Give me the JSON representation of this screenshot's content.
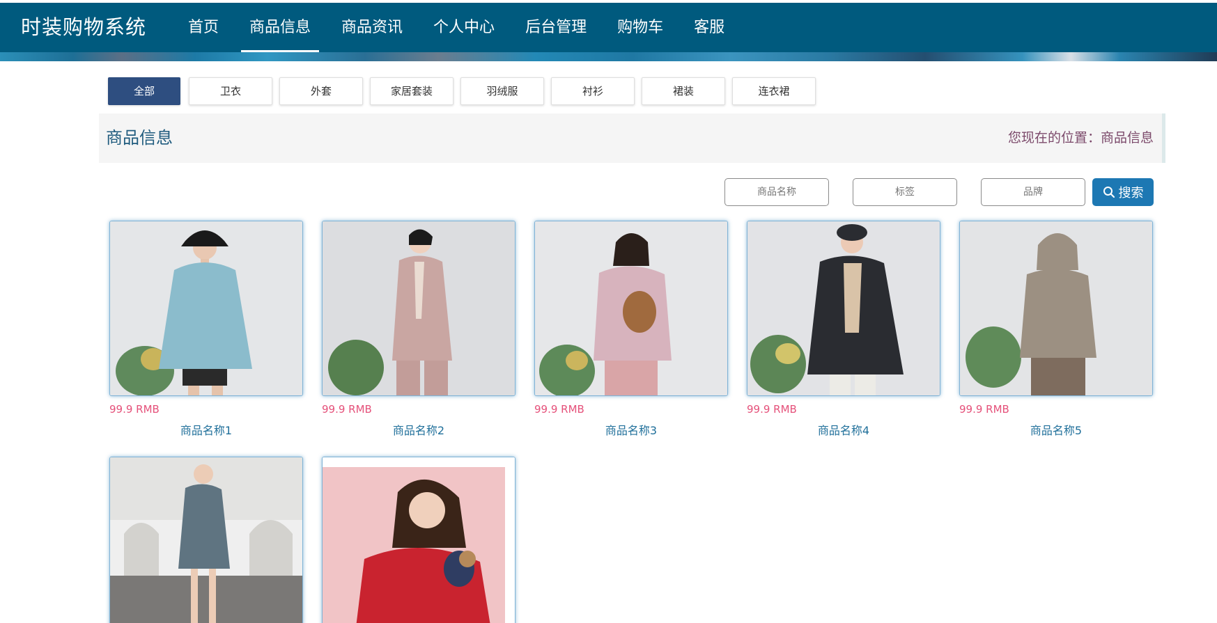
{
  "brand": "时装购物系统",
  "nav": [
    {
      "label": "首页",
      "active": false
    },
    {
      "label": "商品信息",
      "active": true
    },
    {
      "label": "商品资讯",
      "active": false
    },
    {
      "label": "个人中心",
      "active": false
    },
    {
      "label": "后台管理",
      "active": false
    },
    {
      "label": "购物车",
      "active": false
    },
    {
      "label": "客服",
      "active": false
    }
  ],
  "categories": [
    {
      "label": "全部",
      "active": true
    },
    {
      "label": "卫衣"
    },
    {
      "label": "外套"
    },
    {
      "label": "家居套装"
    },
    {
      "label": "羽绒服"
    },
    {
      "label": "衬衫"
    },
    {
      "label": "裙装"
    },
    {
      "label": "连衣裙"
    }
  ],
  "title_bar": {
    "title": "商品信息",
    "breadcrumb": "您现在的位置：商品信息"
  },
  "search": {
    "name_placeholder": "商品名称",
    "tag_placeholder": "标签",
    "brand_placeholder": "品牌",
    "button_label": "搜索",
    "button_icon": "search-icon"
  },
  "products": [
    {
      "price": "99.9 RMB",
      "name": "商品名称1",
      "garment": "light-blue hoodie",
      "color": "#8bbccc"
    },
    {
      "price": "99.9 RMB",
      "name": "商品名称2",
      "garment": "pink blazer suit",
      "color": "#c9a6a2"
    },
    {
      "price": "99.9 RMB",
      "name": "商品名称3",
      "garment": "pink print hoodie",
      "color": "#d7b3bd"
    },
    {
      "price": "99.9 RMB",
      "name": "商品名称4",
      "garment": "black down jacket",
      "color": "#2a2c31"
    },
    {
      "price": "99.9 RMB",
      "name": "商品名称5",
      "garment": "grey knit hoodie",
      "color": "#9c9082"
    },
    {
      "garment": "blue trench dress",
      "color": "#5f7481"
    },
    {
      "garment": "red sweatshirt",
      "color": "#c9232f"
    }
  ],
  "colors": {
    "nav_bg": "#005a7e",
    "active_tab": "#2e4e80",
    "search_button": "#1d78b3",
    "price": "#e5517a",
    "product_name": "#1f6f9a"
  }
}
